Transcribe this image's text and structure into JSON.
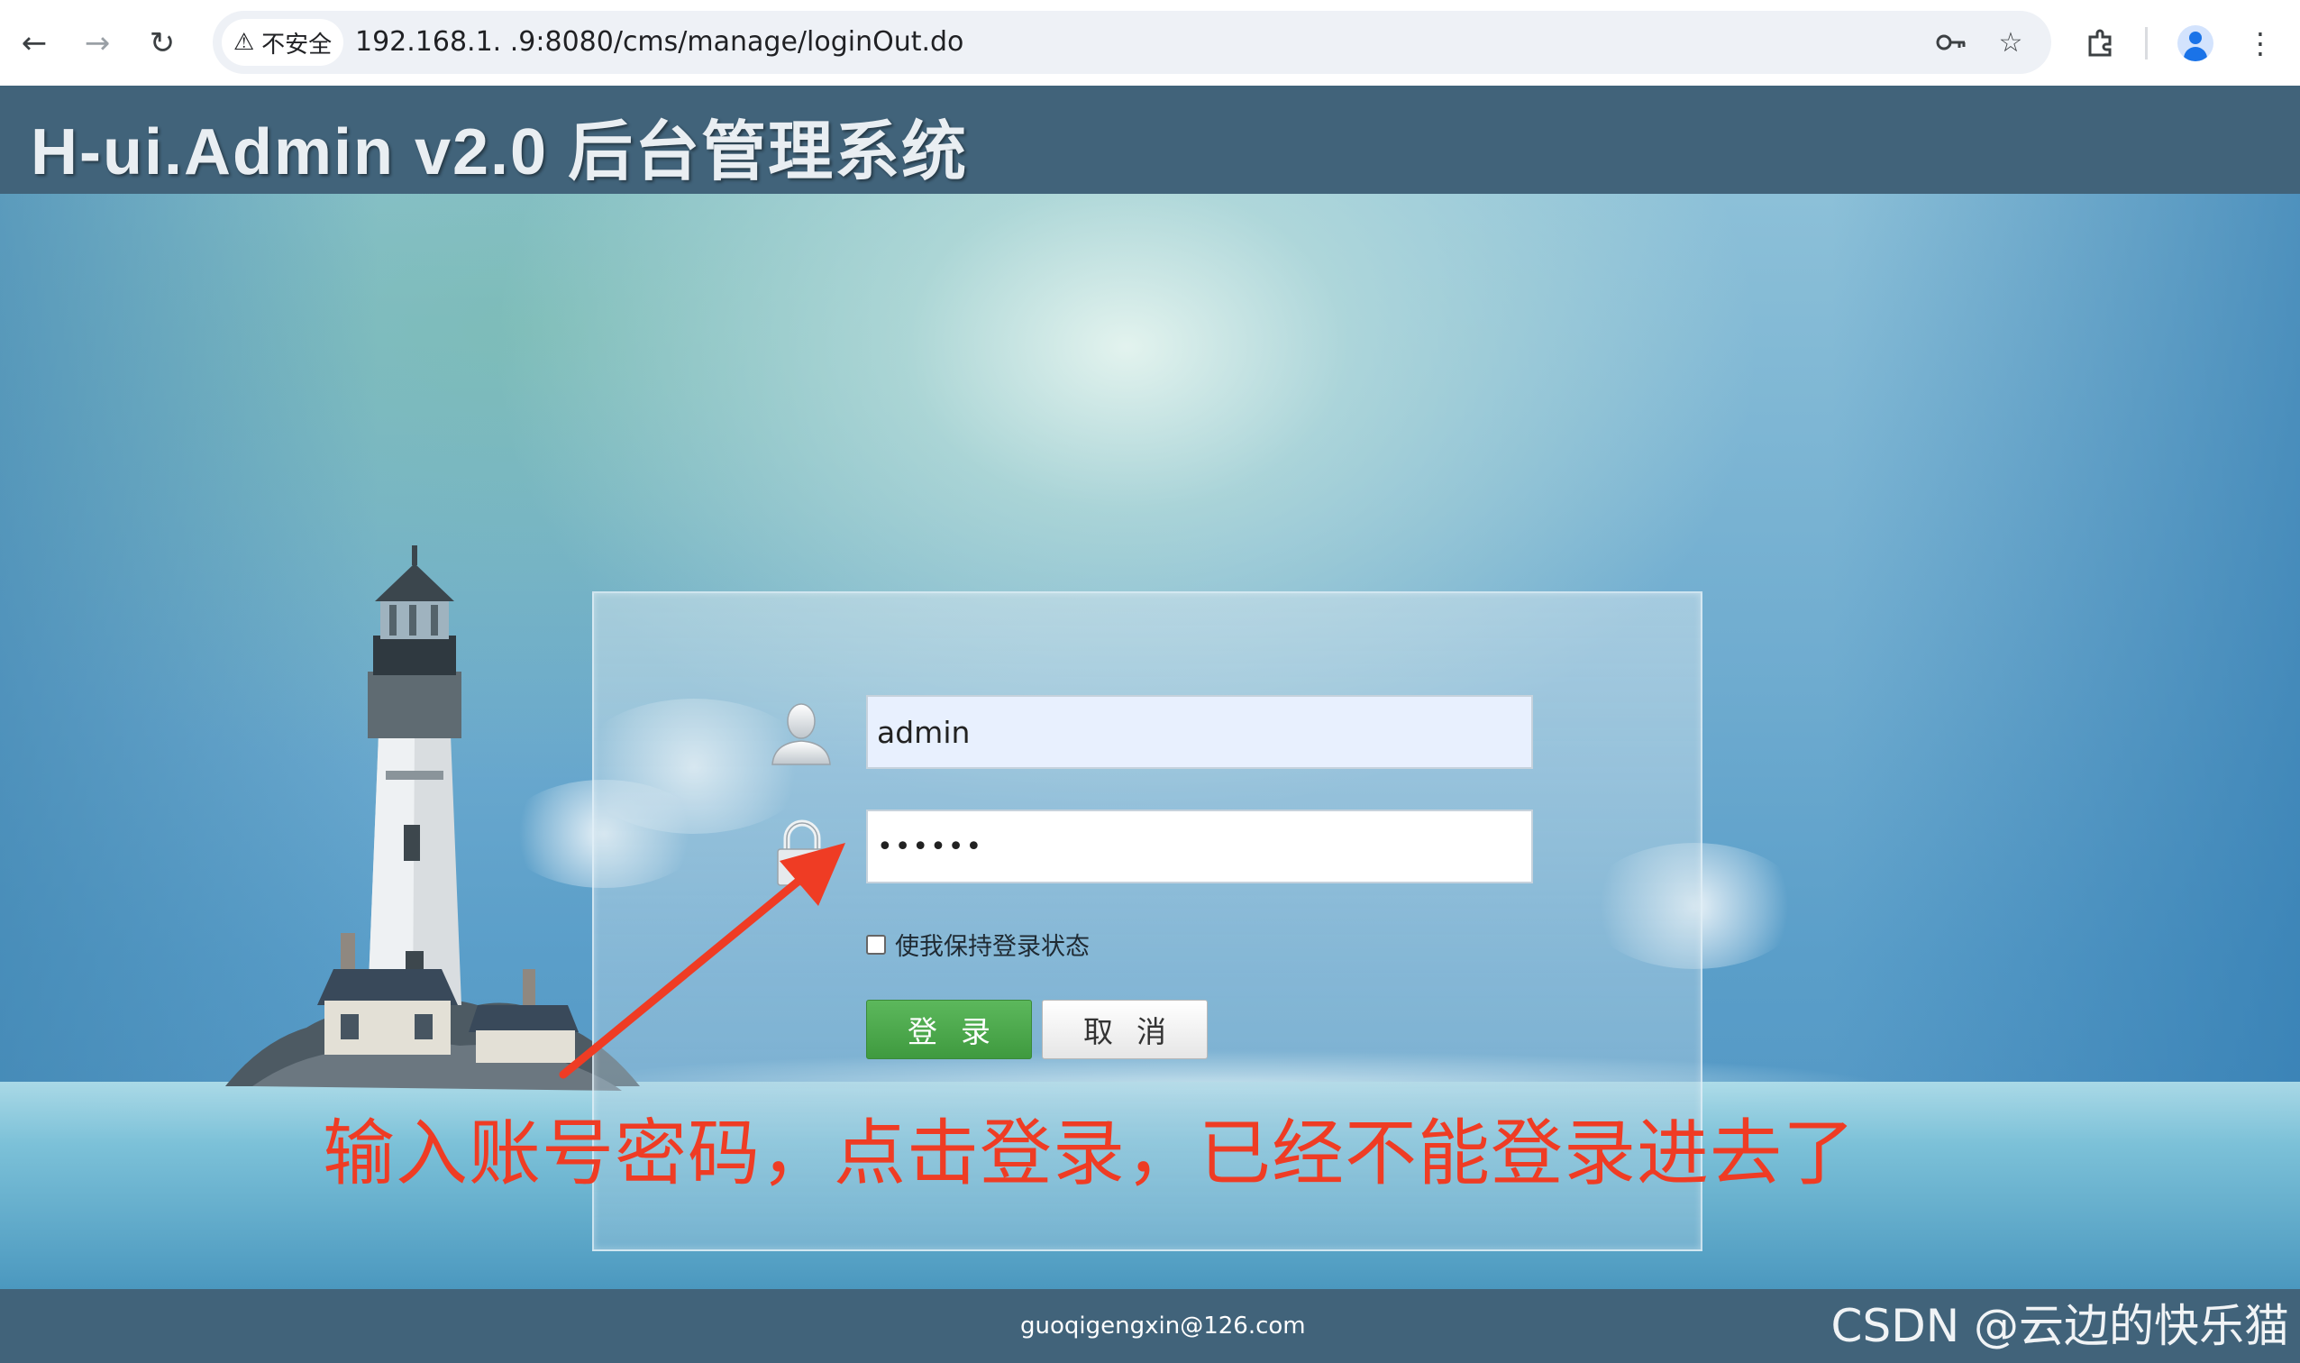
{
  "browser": {
    "security_label": "不安全",
    "url": "192.168.1.  .9:8080/cms/manage/loginOut.do"
  },
  "app": {
    "title": "H-ui.Admin v2.0 后台管理系统"
  },
  "login": {
    "username_value": "admin",
    "password_value": "••••••",
    "remember_label": "使我保持登录状态",
    "remember_checked": false,
    "login_button": "登录",
    "cancel_button": "取消"
  },
  "annotation": {
    "text": "输入账号密码，点击登录，已经不能登录进去了",
    "color": "#ef3c24"
  },
  "footer": {
    "email": "guoqigengxin@126.com"
  },
  "watermark": {
    "text": "CSDN @云边的快乐猫"
  },
  "colors": {
    "header_bg": "#41637a",
    "login_button": "#4cae4c"
  },
  "icons": {
    "back": "back-arrow-icon",
    "forward": "forward-arrow-icon",
    "reload": "reload-icon",
    "warning": "warning-icon",
    "key": "key-icon",
    "star": "bookmark-star-icon",
    "extensions": "extensions-icon",
    "profile": "profile-icon",
    "menu": "kebab-menu-icon",
    "user": "user-icon",
    "lock": "lock-icon"
  }
}
